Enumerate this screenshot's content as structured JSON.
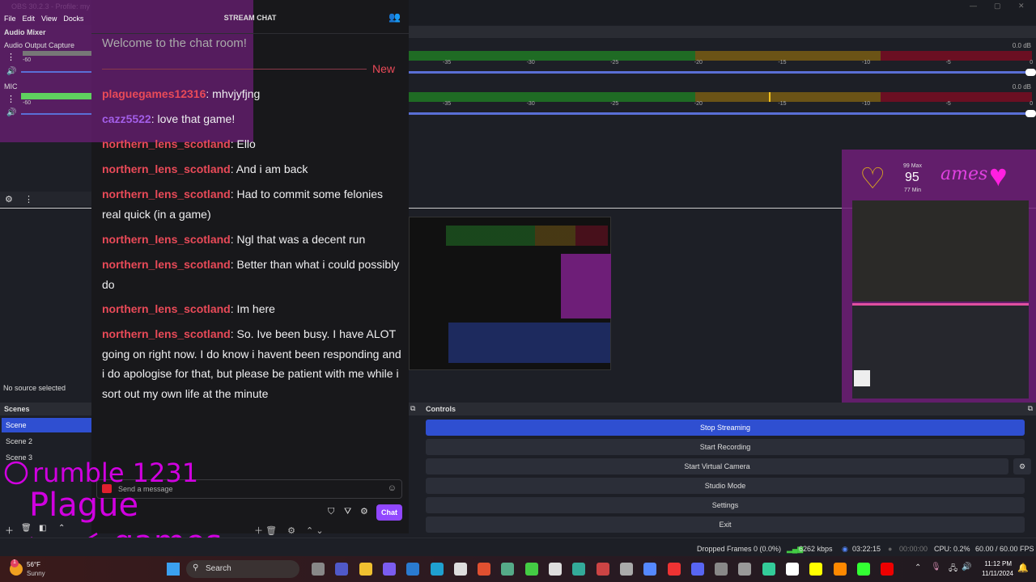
{
  "window": {
    "title": "OBS 30.2.3 - Profile: my stre",
    "menu": [
      "File",
      "Edit",
      "View",
      "Docks"
    ]
  },
  "audio_mixer": {
    "title": "Audio Mixer",
    "sources": [
      {
        "name": "Audio Output Capture",
        "db": "0.0 dB",
        "min_label": "-60"
      },
      {
        "name": "MIC",
        "db": "0.0 dB",
        "min_label": "-60"
      }
    ],
    "tick_labels": [
      "-35",
      "-30",
      "-25",
      "-20",
      "-15",
      "-10",
      "-5",
      "0"
    ]
  },
  "chat": {
    "header": "STREAM CHAT",
    "welcome": "Welcome to the chat room!",
    "new_label": "New",
    "messages": [
      {
        "user": "plaguegames12316",
        "text": ": mhvjyfjng",
        "color": "#e94a58"
      },
      {
        "user": "cazz5522",
        "text": ": love that game!",
        "color": "#a35ee8"
      },
      {
        "user": "northern_lens_scotland",
        "text": ": Ello"
      },
      {
        "user": "northern_lens_scotland",
        "text": ": And i am back"
      },
      {
        "user": "northern_lens_scotland",
        "text": ": Had to commit some felonies real quick (in a game)"
      },
      {
        "user": "northern_lens_scotland",
        "text": ": Ngl that was a decent run"
      },
      {
        "user": "northern_lens_scotland",
        "text": ": Better than what i could possibly do"
      },
      {
        "user": "northern_lens_scotland",
        "text": ": Im here"
      },
      {
        "user": "northern_lens_scotland",
        "text": ": So. Ive been busy. I have ALOT going on right now. I do know i havent been responding and i do apologise for that, but please be patient with me while i sort out my own life at the minute"
      }
    ],
    "input_placeholder": "Send a message",
    "chat_button": "Chat"
  },
  "sources": {
    "empty_label": "No source selected"
  },
  "scenes": {
    "title": "Scenes",
    "items": [
      "Scene",
      "Scene 2",
      "Scene 3"
    ],
    "selected": 0
  },
  "controls": {
    "title": "Controls",
    "buttons": [
      "Stop Streaming",
      "Start Recording",
      "Start Virtual Camera",
      "Studio Mode",
      "Settings",
      "Exit"
    ]
  },
  "heart_widget": {
    "max": "99 Max",
    "value": "95",
    "min": "77 Min"
  },
  "handwriting": [
    "rumble 1231",
    "Plague",
    "games",
    "ames"
  ],
  "status": {
    "dropped": "Dropped Frames 0 (0.0%)",
    "bitrate": "6262 kbps",
    "stream_time": "03:22:15",
    "rec_time": "00:00:00",
    "cpu": "CPU: 0.2%",
    "fps": "60.00 / 60.00 FPS"
  },
  "taskbar": {
    "weather_temp": "56°F",
    "weather_desc": "Sunny",
    "search": "Search",
    "time": "11:12 PM",
    "date": "11/11/2024",
    "weather_badge": "1"
  },
  "colors": {
    "accent": "#2f4fd1",
    "purple_overlay": "#6e1e78",
    "chat_button": "#9147ff",
    "username_red": "#e94a58"
  }
}
